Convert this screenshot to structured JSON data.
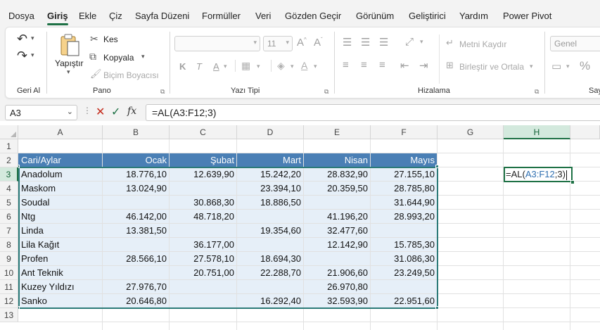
{
  "menu": {
    "tabs": [
      "Dosya",
      "Giriş",
      "Ekle",
      "Çiz",
      "Sayfa Düzeni",
      "Formüller",
      "Veri",
      "Gözden Geçir",
      "Görünüm",
      "Geliştirici",
      "Yardım",
      "Power Pivot"
    ],
    "active": "Giriş"
  },
  "ribbon": {
    "geri_al": {
      "label": "Geri Al"
    },
    "pano": {
      "label": "Pano",
      "paste": "Yapıştır",
      "cut": "Kes",
      "copy": "Kopyala",
      "format_painter": "Biçim Boyacısı"
    },
    "yazi_tipi": {
      "label": "Yazı Tipi",
      "font_size": "11",
      "bold": "K",
      "italic": "T",
      "underline": "A"
    },
    "hizalama": {
      "label": "Hizalama",
      "wrap": "Metni Kaydır",
      "merge": "Birleştir ve Ortala"
    },
    "sayi": {
      "label": "Say",
      "format": "Genel",
      "percent": "%"
    }
  },
  "formula_bar": {
    "name_box": "A3",
    "formula": "=AL(A3:F12;3)"
  },
  "grid": {
    "columns": [
      "A",
      "B",
      "C",
      "D",
      "E",
      "F",
      "G",
      "H"
    ],
    "rows": [
      "1",
      "2",
      "3",
      "4",
      "5",
      "6",
      "7",
      "8",
      "9",
      "10",
      "11",
      "12",
      "13"
    ],
    "selected_column": "H",
    "selected_row": "3"
  },
  "table": {
    "headers": [
      "Cari/Aylar",
      "Ocak",
      "Şubat",
      "Mart",
      "Nisan",
      "Mayıs"
    ],
    "rows": [
      [
        "Anadolum",
        "18.776,10",
        "12.639,90",
        "15.242,20",
        "28.832,90",
        "27.155,10"
      ],
      [
        "Maskom",
        "13.024,90",
        "",
        "23.394,10",
        "20.359,50",
        "28.785,80"
      ],
      [
        "Soudal",
        "",
        "30.868,30",
        "18.886,50",
        "",
        "31.644,90"
      ],
      [
        "Ntg",
        "46.142,00",
        "48.718,20",
        "",
        "41.196,20",
        "28.993,20"
      ],
      [
        "Linda",
        "13.381,50",
        "",
        "19.354,60",
        "32.477,60",
        ""
      ],
      [
        "Lila Kağıt",
        "",
        "36.177,00",
        "",
        "12.142,90",
        "15.785,30"
      ],
      [
        "Profen",
        "28.566,10",
        "27.578,10",
        "18.694,30",
        "",
        "31.086,30"
      ],
      [
        "Ant Teknik",
        "",
        "20.751,00",
        "22.288,70",
        "21.906,60",
        "23.249,50"
      ],
      [
        "Kuzey Yıldızı",
        "27.976,70",
        "",
        "",
        "26.970,80",
        ""
      ],
      [
        "Sanko",
        "20.646,80",
        "",
        "16.292,40",
        "32.593,90",
        "22.951,60"
      ]
    ]
  },
  "edit_cell": {
    "prefix": "=AL(",
    "ref": "A3:F12",
    "suffix": ";3)"
  },
  "colors": {
    "accent": "#1e7145",
    "table_header": "#4a7fb5",
    "range_fill": "#e6eff8",
    "range_border": "#2b7a78"
  }
}
